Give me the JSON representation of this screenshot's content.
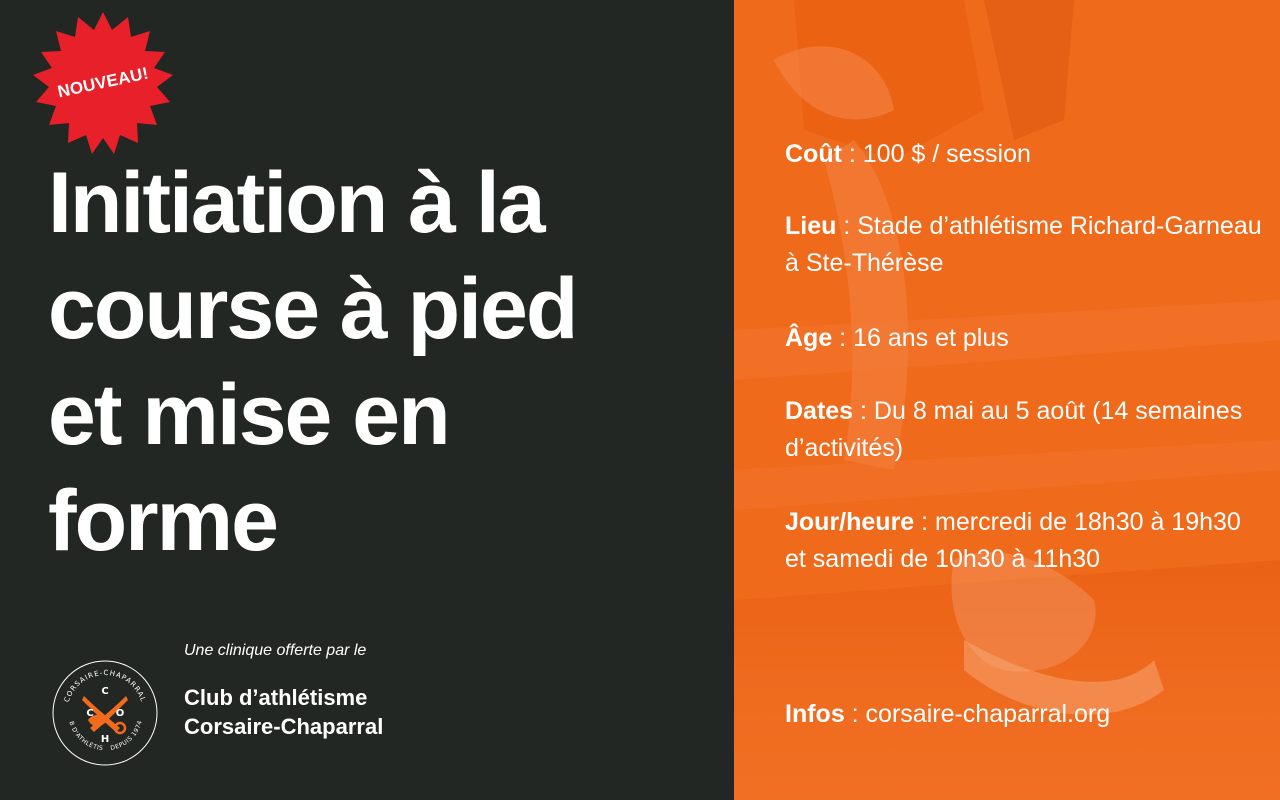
{
  "badge": {
    "label": "NOUVEAU!",
    "color": "#e8202a"
  },
  "title_lines": [
    "Initiation à la",
    "course à pied",
    "et mise en",
    "forme"
  ],
  "offer_text": "Une clinique offerte par le",
  "club_name": [
    "Club d’athlétisme",
    "Corsaire-Chaparral"
  ],
  "logo": {
    "ring_top_text": "CORSAIRE-CHAPARRAL",
    "ring_bottom_left_text": "CLUB D'ATHLÉTISME",
    "ring_bottom_right_text": "DEPUIS 1974",
    "letters": [
      "C",
      "C",
      "O",
      "H"
    ],
    "icon": "crossed-swords-icon",
    "accent": "#f26a1e"
  },
  "info": [
    {
      "label": "Coût",
      "value": " : 100 $ / session"
    },
    {
      "label": "Lieu",
      "value": " : Stade d’athlétisme Richard-Garneau à Ste-Thérèse"
    },
    {
      "label": "Âge",
      "value": " : 16 ans et plus"
    },
    {
      "label": "Dates",
      "value": " : Du 8 mai au 5 août (14 semaines d’activités)"
    },
    {
      "label": "Jour/heure",
      "value": " : mercredi de 18h30 à 19h30 et samedi de 10h30 à 11h30"
    },
    {
      "label": "Infos",
      "value": " : corsaire-chaparral.org"
    }
  ],
  "colors": {
    "dark_panel": "#232723",
    "orange_panel": "#f26a1e",
    "text": "#ffffff"
  }
}
